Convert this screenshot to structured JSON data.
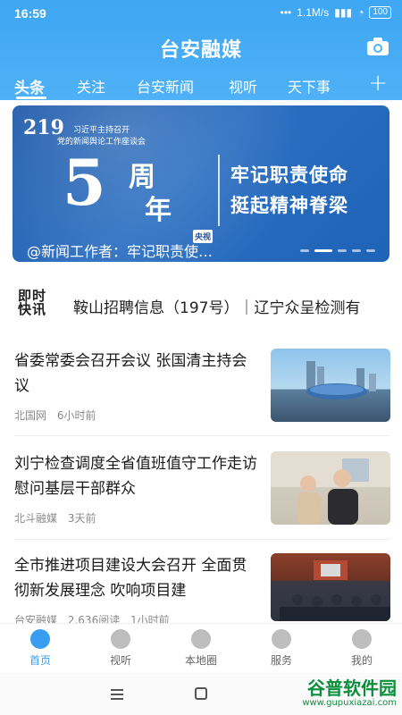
{
  "status_bar": {
    "time": "16:59",
    "speed": "1.1M/s",
    "battery": "100"
  },
  "header": {
    "brand": "台安融媒"
  },
  "tabs": [
    "头条",
    "关注",
    "台安新闻",
    "视听",
    "天下事"
  ],
  "banner": {
    "badge": "219",
    "subtitle1": "习近平主持召开",
    "subtitle2": "党的新闻舆论工作座谈会",
    "number": "5",
    "zhou": "周",
    "nian": "年",
    "line1": "牢记职责使命",
    "line2": "挺起精神脊梁",
    "caption": "@新闻工作者：牢记职责使…",
    "source_tag": "央视"
  },
  "ticker": {
    "logo_line1": "即时",
    "logo_line2": "快讯",
    "text": "鞍山招聘信息（197号）｜辽宁众呈检测有"
  },
  "news": [
    {
      "title": "省委常委会召开会议 张国清主持会议",
      "source": "北国网",
      "views": "",
      "time": "6小时前"
    },
    {
      "title": "刘宁检查调度全省值班值守工作走访慰问基层干部群众",
      "source": "北斗融媒",
      "views": "",
      "time": "3天前"
    },
    {
      "title": "全市推进项目建设大会召开 全面贯彻新发展理念 吹响项目建",
      "source": "台安融媒",
      "views": "2,636阅读",
      "time": "1小时前"
    }
  ],
  "bottom_nav": [
    "首页",
    "视听",
    "本地圈",
    "服务",
    "我的"
  ],
  "watermark": {
    "name": "谷普软件园",
    "url": "www.gupuxiazai.com"
  },
  "colors": {
    "accent": "#3ea6f3",
    "active_nav": "#3a9ef0"
  }
}
